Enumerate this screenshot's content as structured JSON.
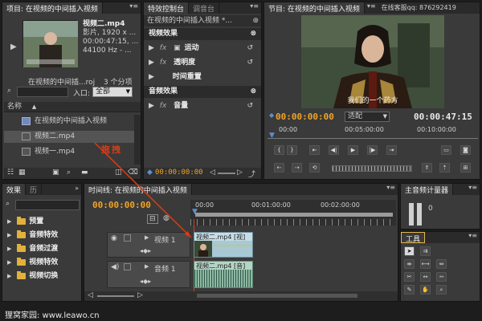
{
  "project": {
    "tab_label": "项目: 在视频的中间插入视频",
    "clip_name": "视频二.mp4",
    "clip_type": "影片, 1920 x ...",
    "clip_duration": "00:00:47:15, ...",
    "clip_audio": "44100 Hz - ...",
    "project_file": "在视频的中间插...roj",
    "item_count": "3 个分项",
    "search_in_label": "入口:",
    "search_in_value": "全部",
    "column_name": "名称",
    "items": [
      "在视频的中间插入视频",
      "视频二.mp4",
      "视频一.mp4"
    ]
  },
  "effect_controls": {
    "tab_label": "特效控制台",
    "mixer_tab_label": "调音台",
    "sequence_label": "在视频的中间插入视频 *...",
    "video_effects_header": "视频效果",
    "motion": "运动",
    "opacity": "透明度",
    "time_remap": "时间重置",
    "audio_effects_header": "音频效果",
    "volume": "音量",
    "timecode": "00:00:00:00"
  },
  "program": {
    "tab_label": "节目: 在视频的中间插入视频",
    "watermark": "在线客服qq: 876292419",
    "subtitle": "我们的一个药方",
    "timecode_current": "00:00:00:00",
    "fit_label": "适配",
    "timecode_duration": "00:00:47:15",
    "ruler": [
      "00:00",
      "00:05:00:00",
      "00:10:00:00"
    ]
  },
  "effects_panel": {
    "tab_label": "效果",
    "history_tab_label": "历",
    "folders": [
      "预置",
      "音频特效",
      "音频过渡",
      "视频特效",
      "视频切换"
    ]
  },
  "timeline": {
    "tab_label": "时间线: 在视频的中间插入视频",
    "timecode": "00:00:00:00",
    "ruler": [
      "00:00",
      "00:01:00:00",
      "00:02:00:00"
    ],
    "video_track_label": "视频 1",
    "audio_track_label": "音频 1",
    "video_clip_label": "视频二.mp4 [视]",
    "audio_clip_label": "视频二.mp4 [音]"
  },
  "audio_meters": {
    "tab_label": "主音频计量器",
    "value": "0"
  },
  "tools": {
    "tab_label": "工具"
  },
  "annotation": {
    "drag_label": "拖拽"
  },
  "footer": {
    "site_text": "狸窝家园: www.leawo.cn"
  },
  "colors": {
    "timecode_orange": "#f0a325",
    "annotation_red": "#e03a10",
    "folder_yellow": "#e2b13c"
  }
}
